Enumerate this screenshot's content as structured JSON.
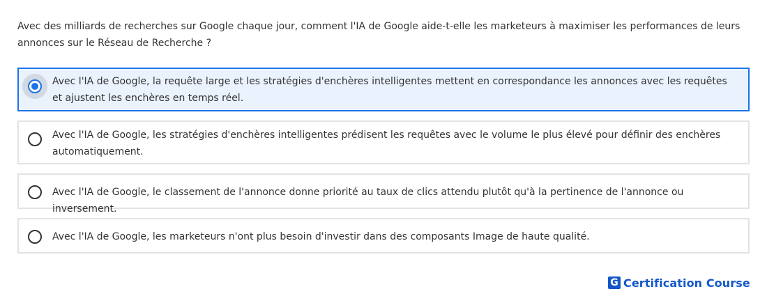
{
  "question": {
    "text": "Avec des milliards de recherches sur Google chaque jour, comment l'IA de Google aide-t-elle les marketeurs à maximiser les performances de leurs annonces sur le Réseau de Recherche ?"
  },
  "options": [
    {
      "label": "Avec l'IA de Google, la requête large et les stratégies d'enchères intelligentes mettent en correspondance les annonces avec les requêtes et ajustent les enchères en temps réel.",
      "selected": true
    },
    {
      "label": "Avec l'IA de Google, les stratégies d'enchères intelligentes prédisent les requêtes avec le volume le plus élevé pour définir des enchères automatiquement.",
      "selected": false
    },
    {
      "label": "Avec l'IA de Google, le classement de l'annonce donne priorité au taux de clics attendu plutôt qu'à la pertinence de l'annonce ou inversement.",
      "selected": false
    },
    {
      "label": "Avec l'IA de Google, les marketeurs n'ont plus besoin d'investir dans des composants Image de haute qualité.",
      "selected": false
    }
  ],
  "brand": {
    "icon_letter": "G",
    "name": "Certification Course"
  },
  "colors": {
    "accent": "#1a73e8",
    "brand": "#1457c8",
    "selected_background": "#eaf2fd",
    "border": "#e3e3e3",
    "text": "#333333"
  }
}
